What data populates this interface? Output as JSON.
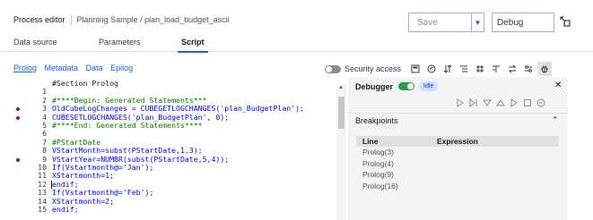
{
  "header": {
    "app_name": "Process editor",
    "path": "Planning Sample / plan_load_budget_ascii",
    "save_select_value": "Save",
    "debug_label": "Debug"
  },
  "tabs": [
    "Data source",
    "Parameters",
    "Script"
  ],
  "active_tab": "Script",
  "script_sections": [
    "Prolog",
    "Metadata",
    "Data",
    "Epilog"
  ],
  "active_section": "Prolog",
  "toolbar": {
    "security_access_label": "Security access",
    "icons": [
      "calculator-icon",
      "function-icon",
      "sort-icon",
      "list-icon",
      "hash-icon",
      "text-icon",
      "replace-icon",
      "settings-icon",
      "debug-bug-icon"
    ]
  },
  "editor": {
    "lines": [
      {
        "n": "",
        "text": "#Section Prolog",
        "style": "sec",
        "bp": false
      },
      {
        "n": "1",
        "text": "",
        "style": "plain",
        "bp": false
      },
      {
        "n": "2",
        "text": "#****Begin: Generated Statements***",
        "style": "cmt",
        "bp": false
      },
      {
        "n": "3",
        "text": "OldCubeLogChanges = CUBEGETLOGCHANGES('plan_BudgetPlan');",
        "style": "kw",
        "bp": true
      },
      {
        "n": "4",
        "text": "CUBESETLOGCHANGES('plan_BudgetPlan', 0);",
        "style": "kw",
        "bp": true
      },
      {
        "n": "5",
        "text": "#****End: Generated Statements****",
        "style": "cmt",
        "bp": false
      },
      {
        "n": "6",
        "text": "",
        "style": "plain",
        "bp": false
      },
      {
        "n": "7",
        "text": "#PStartDate",
        "style": "cmt",
        "bp": false
      },
      {
        "n": "8",
        "text": "VStartMonth=subst(PStartDate,1,3);",
        "style": "kw",
        "bp": false
      },
      {
        "n": "9",
        "text": "VStartYear=NUMBR(subst(PStartDate,5,4));",
        "style": "kw",
        "bp": true
      },
      {
        "n": "10",
        "text": "If(Vstartmonth@='Jan');",
        "style": "kw",
        "bp": false
      },
      {
        "n": "11",
        "text": "XStartmonth=1;",
        "style": "kw",
        "bp": false
      },
      {
        "n": "12",
        "text": "endif;",
        "style": "kw",
        "bp": false
      },
      {
        "n": "13",
        "text": "If(Vstartmonth@='Feb');",
        "style": "kw",
        "bp": false
      },
      {
        "n": "14",
        "text": "XStartmonth=2;",
        "style": "kw",
        "bp": false
      },
      {
        "n": "15",
        "text": "endif;",
        "style": "kw",
        "bp": false
      }
    ]
  },
  "debugger": {
    "title": "Debugger",
    "status": "Idle",
    "breakpoints_title": "Breakpoints",
    "columns": [
      "Line",
      "Expression"
    ],
    "breakpoints": [
      "Prolog(3)",
      "Prolog(4)",
      "Prolog(9)",
      "Prolog(16)"
    ]
  },
  "colors": {
    "accent": "#0f62fe",
    "comment": "#008000",
    "keyword": "#0000ff",
    "breakpoint": "#a2191f",
    "toggle_on": "#24a148",
    "panel_bg": "#f4f4f4"
  }
}
